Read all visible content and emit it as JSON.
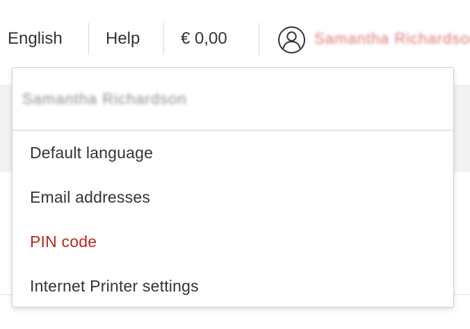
{
  "topbar": {
    "language": "English",
    "help": "Help",
    "balance": "€ 0,00",
    "user_icon": "user-circle-icon",
    "username": "Samantha Richardson"
  },
  "dropdown": {
    "account_name": "Samantha Richardson",
    "items": [
      {
        "label": "Default language"
      },
      {
        "label": "Email addresses"
      },
      {
        "label": "PIN code",
        "active": true
      },
      {
        "label": "Internet Printer settings"
      }
    ]
  },
  "colors": {
    "text": "#333333",
    "active": "#b52a1f",
    "border": "#cfcfcf",
    "separator": "#d4d4d4"
  }
}
